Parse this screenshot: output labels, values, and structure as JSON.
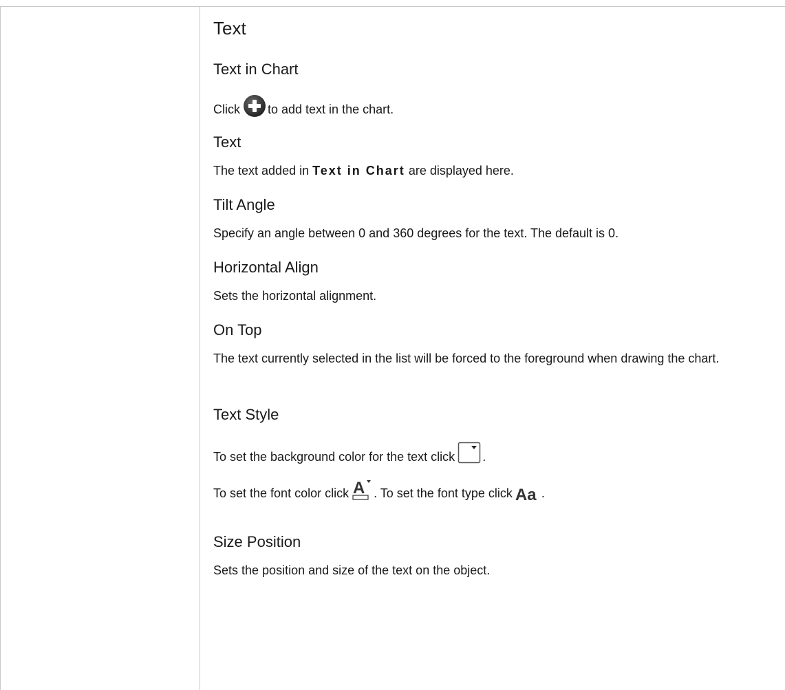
{
  "title": "Text",
  "sections": {
    "text_in_chart": {
      "heading": "Text in Chart",
      "pre": "Click",
      "post": "to add text in the chart."
    },
    "text": {
      "heading": "Text",
      "pre": "The text added in",
      "bold": "Text in Chart",
      "post": "are displayed here."
    },
    "tilt_angle": {
      "heading": "Tilt Angle",
      "body": "Specify an angle between 0 and 360 degrees for the text. The default is 0."
    },
    "horizontal_align": {
      "heading": "Horizontal Align",
      "body": "Sets the horizontal alignment."
    },
    "on_top": {
      "heading": "On Top",
      "body": "The text currently selected in the list will be forced to the foreground when drawing the chart."
    },
    "text_style": {
      "heading": "Text Style",
      "line1_pre": "To set the background color for the text click",
      "line1_post": ".",
      "line2_pre": "To set the font color click",
      "line2_mid": ". To set the font type click",
      "line2_post": "."
    },
    "size_position": {
      "heading": "Size Position",
      "body": "Sets the position and size of the text on the object."
    }
  },
  "icons": {
    "add": "plus-circle-icon",
    "background_color": "dropdown-box-icon",
    "font_color": "font-color-icon",
    "font_type": "font-type-icon",
    "font_type_label": "Aa"
  },
  "colors": {
    "text": "#1a1a1a",
    "border": "#c8c8c8",
    "icon_dark": "#333333"
  }
}
